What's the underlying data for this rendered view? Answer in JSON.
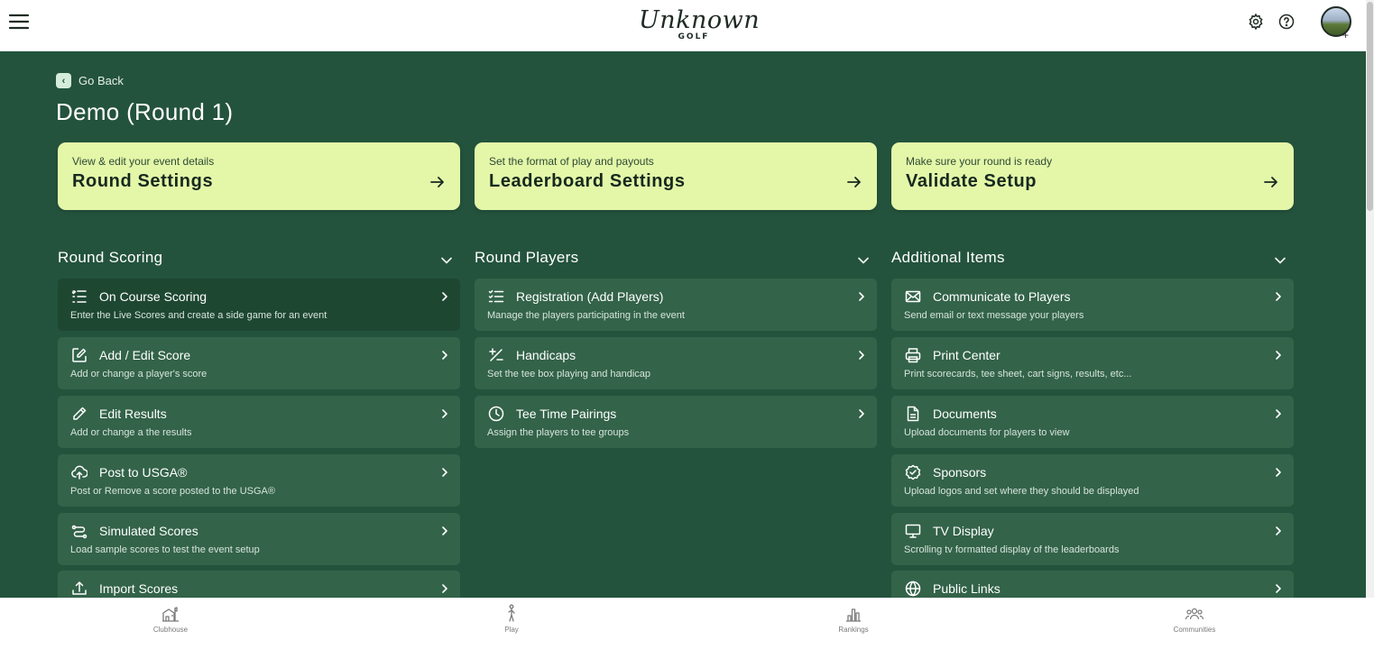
{
  "header": {
    "logo_script": "Unknown",
    "logo_sub": "GOLF",
    "avatar_plus": "+"
  },
  "nav": {
    "go_back": "Go Back"
  },
  "page": {
    "title": "Demo (Round 1)"
  },
  "hero_cards": [
    {
      "sub": "View & edit your event details",
      "title": "Round Settings"
    },
    {
      "sub": "Set the format of play and payouts",
      "title": "Leaderboard Settings"
    },
    {
      "sub": "Make sure your round is ready",
      "title": "Validate Setup"
    }
  ],
  "sections": [
    {
      "title": "Round Scoring",
      "items": [
        {
          "title": "On Course Scoring",
          "sub": "Enter the Live Scores and create a side game for an event",
          "icon": "list-check-icon",
          "active": true
        },
        {
          "title": "Add / Edit Score",
          "sub": "Add or change a player's score",
          "icon": "edit-square-icon"
        },
        {
          "title": "Edit Results",
          "sub": "Add or change a the results",
          "icon": "pencil-icon"
        },
        {
          "title": "Post to USGA®",
          "sub": "Post or Remove a score posted to the USGA®",
          "icon": "cloud-upload-icon"
        },
        {
          "title": "Simulated Scores",
          "sub": "Load sample scores to test the event setup",
          "icon": "route-icon"
        },
        {
          "title": "Import Scores",
          "sub": "",
          "icon": "upload-icon"
        }
      ]
    },
    {
      "title": "Round Players",
      "items": [
        {
          "title": "Registration (Add Players)",
          "sub": "Manage the players participating in the event",
          "icon": "checklist-icon"
        },
        {
          "title": "Handicaps",
          "sub": "Set the tee box playing and handicap",
          "icon": "plus-minus-icon"
        },
        {
          "title": "Tee Time Pairings",
          "sub": "Assign the players to tee groups",
          "icon": "clock-icon"
        }
      ]
    },
    {
      "title": "Additional Items",
      "items": [
        {
          "title": "Communicate to Players",
          "sub": "Send email or text message your players",
          "icon": "mail-icon"
        },
        {
          "title": "Print Center",
          "sub": "Print scorecards, tee sheet, cart signs, results, etc...",
          "icon": "printer-icon"
        },
        {
          "title": "Documents",
          "sub": "Upload documents for players to view",
          "icon": "document-icon"
        },
        {
          "title": "Sponsors",
          "sub": "Upload logos and set where they should be displayed",
          "icon": "badge-check-icon"
        },
        {
          "title": "TV Display",
          "sub": "Scrolling tv formatted display of the leaderboards",
          "icon": "monitor-icon"
        },
        {
          "title": "Public Links",
          "sub": "",
          "icon": "globe-icon"
        }
      ]
    }
  ],
  "bottom_nav": [
    {
      "label": "Clubhouse",
      "icon": "clubhouse-icon"
    },
    {
      "label": "Play",
      "icon": "golfer-icon"
    },
    {
      "label": "Rankings",
      "icon": "bar-chart-icon"
    },
    {
      "label": "Communities",
      "icon": "people-icon"
    }
  ],
  "colors": {
    "main_bg": "#24533d",
    "card_bg": "#336349",
    "card_active": "#1e4732",
    "hero_bg": "#e4f6a8"
  }
}
